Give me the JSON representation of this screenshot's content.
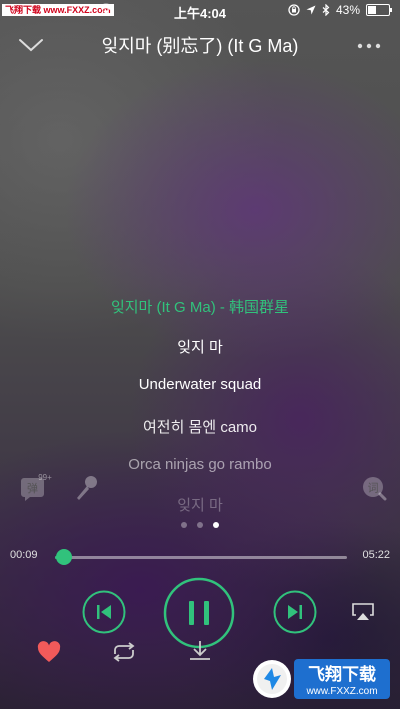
{
  "status_bar": {
    "watermark_tl": "飞翔下载 www.FXXZ.com",
    "time": "上午4:04",
    "battery_percent": "43%",
    "battery_level": 0.43
  },
  "header": {
    "title": "잊지마 (别忘了) (It G Ma)",
    "back_icon": "chevron-down-icon",
    "more_icon": "more-icon"
  },
  "lyrics": {
    "song_line": "잊지마 (It G Ma) - 韩国群星",
    "lines": [
      "잊지 마",
      "Underwater squad",
      "여전히 몸엔 camo",
      "Orca ninjas go rambo",
      "잊지 마"
    ],
    "accent_color": "#31c27c"
  },
  "side": {
    "comment_badge": "99+",
    "comment_label": "弹",
    "word_label": "词"
  },
  "pager": {
    "count": 3,
    "active_index": 2
  },
  "progress": {
    "current": "00:09",
    "total": "05:22",
    "fraction": 0.03
  },
  "watermark_br": {
    "brand": "飞翔下载",
    "url": "www.FXXZ.com"
  },
  "colors": {
    "accent": "#31c27c",
    "heart": "#f25a5a"
  }
}
